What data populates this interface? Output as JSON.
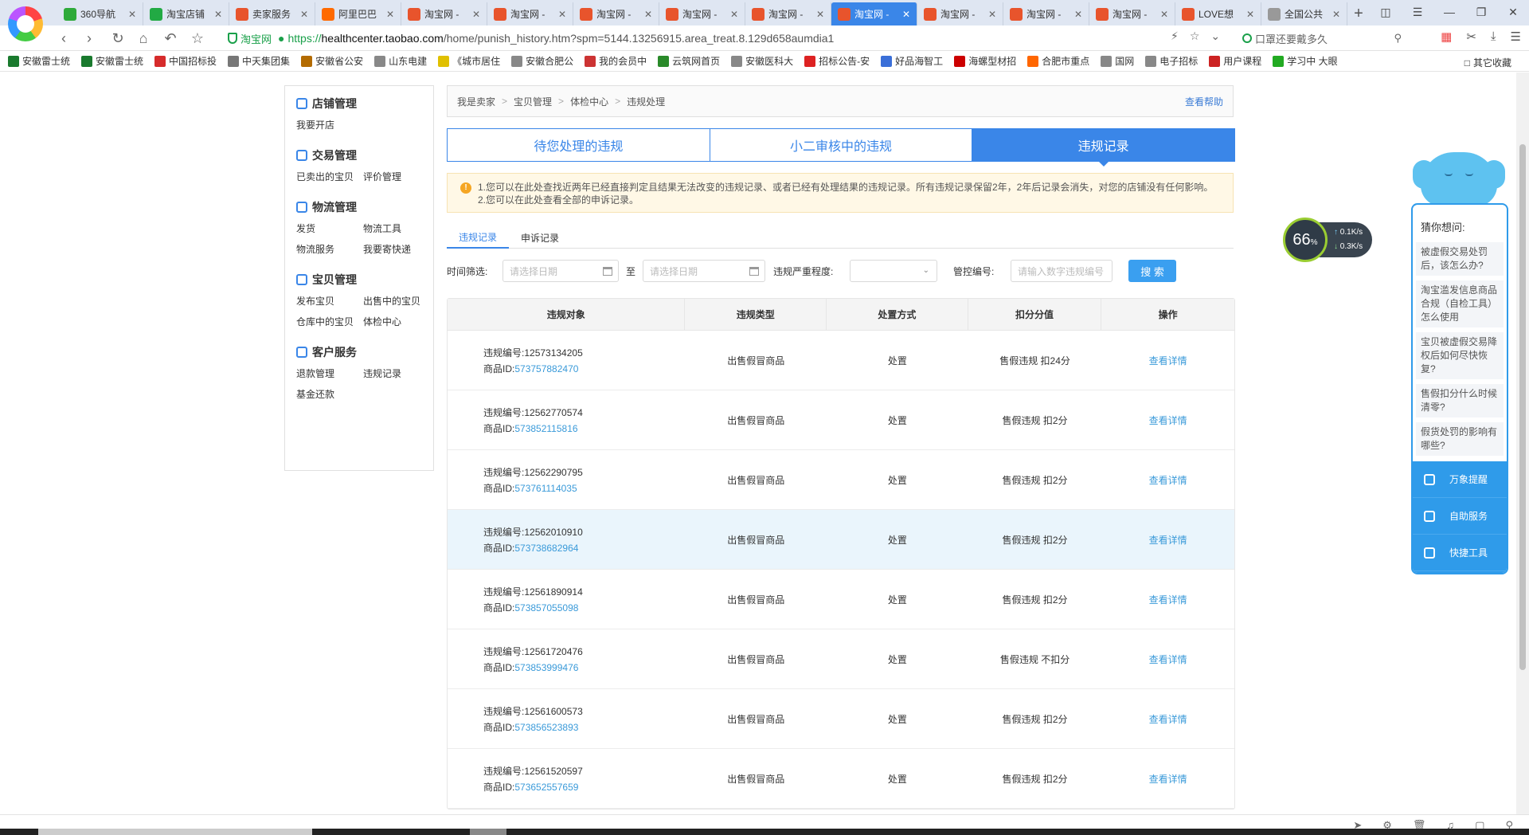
{
  "browser": {
    "tabs": [
      {
        "label": "360导航",
        "fav": "#2eaa3a"
      },
      {
        "label": "淘宝店铺",
        "fav": "#22aa44"
      },
      {
        "label": "卖家服务",
        "fav": "#e8542c"
      },
      {
        "label": "阿里巴巴",
        "fav": "#ff6a00"
      },
      {
        "label": "淘宝网 -",
        "fav": "#e8542c"
      },
      {
        "label": "淘宝网 -",
        "fav": "#e8542c"
      },
      {
        "label": "淘宝网 -",
        "fav": "#e8542c"
      },
      {
        "label": "淘宝网 -",
        "fav": "#e8542c"
      },
      {
        "label": "淘宝网 -",
        "fav": "#e8542c"
      },
      {
        "label": "淘宝网 -",
        "fav": "#e8542c",
        "active": true
      },
      {
        "label": "淘宝网 -",
        "fav": "#e8542c"
      },
      {
        "label": "淘宝网 -",
        "fav": "#e8542c"
      },
      {
        "label": "淘宝网 -",
        "fav": "#e8542c"
      },
      {
        "label": "LOVE想",
        "fav": "#e8542c"
      },
      {
        "label": "全国公共",
        "fav": "#999999"
      }
    ],
    "address": {
      "secure_label": "淘宝网",
      "scheme": "https://",
      "host": "healthcenter.taobao.com",
      "path": "/home/punish_history.htm?spm=5144.13256915.area_treat.8.129d658aumdia1"
    },
    "search_placeholder": "口罩还要戴多久",
    "bookmarks": [
      "安徽雷士统",
      "安徽雷士统",
      "中国招标投",
      "中天集团集",
      "安徽省公安",
      "山东电建",
      "《城市居住",
      "安徽合肥公",
      "我的会员中",
      "云筑网首页",
      "安徽医科大",
      "招标公告-安",
      "好品海智工",
      "海螺型材招",
      "合肥市重点",
      "国网",
      "电子招标",
      "用户课程",
      "学习中 大眼"
    ],
    "other_bookmarks": "其它收藏"
  },
  "sidebar": {
    "sections": [
      {
        "title": "店铺管理",
        "icon": "shop-icon",
        "items": [
          "我要开店"
        ]
      },
      {
        "title": "交易管理",
        "icon": "trade-icon",
        "items": [
          "已卖出的宝贝",
          "评价管理"
        ]
      },
      {
        "title": "物流管理",
        "icon": "truck-icon",
        "items": [
          "发货",
          "物流工具",
          "物流服务",
          "我要寄快递"
        ]
      },
      {
        "title": "宝贝管理",
        "icon": "bag-icon",
        "items": [
          "发布宝贝",
          "出售中的宝贝",
          "仓库中的宝贝",
          "体检中心"
        ]
      },
      {
        "title": "客户服务",
        "icon": "headset-icon",
        "items": [
          "退款管理",
          "违规记录",
          "基金还款"
        ]
      }
    ]
  },
  "breadcrumb": {
    "items": [
      "我是卖家",
      "宝贝管理",
      "体检中心",
      "违规处理"
    ],
    "help": "查看帮助"
  },
  "main_tabs": [
    {
      "label": "待您处理的违规"
    },
    {
      "label": "小二审核中的违规"
    },
    {
      "label": "违规记录",
      "active": true
    }
  ],
  "notice": {
    "line1": "1.您可以在此处查找近两年已经直接判定且结果无法改变的违规记录、或者已经有处理结果的违规记录。所有违规记录保留2年，2年后记录会消失，对您的店铺没有任何影响。",
    "line2": "2.您可以在此处查看全部的申诉记录。"
  },
  "sub_tabs": [
    {
      "label": "违规记录",
      "active": true
    },
    {
      "label": "申诉记录"
    }
  ],
  "filters": {
    "time_label": "时间筛选:",
    "date_placeholder": "请选择日期",
    "to": "至",
    "severity_label": "违规严重程度:",
    "control_label": "管控编号:",
    "control_placeholder": "请输入数字违规编号",
    "search_button": "搜 索"
  },
  "table": {
    "headers": [
      "违规对象",
      "违规类型",
      "处置方式",
      "扣分分值",
      "操作"
    ],
    "id_prefix": "违规编号:",
    "item_prefix": "商品ID:",
    "rows": [
      {
        "violation_id": "12573134205",
        "item_id": "573757882470",
        "type": "出售假冒商品",
        "method": "处置",
        "score": "售假违规 扣24分",
        "action": "查看详情"
      },
      {
        "violation_id": "12562770574",
        "item_id": "573852115816",
        "type": "出售假冒商品",
        "method": "处置",
        "score": "售假违规 扣2分",
        "action": "查看详情"
      },
      {
        "violation_id": "12562290795",
        "item_id": "573761114035",
        "type": "出售假冒商品",
        "method": "处置",
        "score": "售假违规 扣2分",
        "action": "查看详情"
      },
      {
        "violation_id": "12562010910",
        "item_id": "573738682964",
        "type": "出售假冒商品",
        "method": "处置",
        "score": "售假违规 扣2分",
        "action": "查看详情",
        "highlight": true
      },
      {
        "violation_id": "12561890914",
        "item_id": "573857055098",
        "type": "出售假冒商品",
        "method": "处置",
        "score": "售假违规 扣2分",
        "action": "查看详情"
      },
      {
        "violation_id": "12561720476",
        "item_id": "573853999476",
        "type": "出售假冒商品",
        "method": "处置",
        "score": "售假违规 不扣分",
        "action": "查看详情"
      },
      {
        "violation_id": "12561600573",
        "item_id": "573856523893",
        "type": "出售假冒商品",
        "method": "处置",
        "score": "售假违规 扣2分",
        "action": "查看详情"
      },
      {
        "violation_id": "12561520597",
        "item_id": "573652557659",
        "type": "出售假冒商品",
        "method": "处置",
        "score": "售假违规 扣2分",
        "action": "查看详情"
      }
    ]
  },
  "speed_widget": {
    "percent": "66",
    "unit": "%",
    "up": "0.1",
    "down": "0.3",
    "rate_unit": "K/s"
  },
  "helper": {
    "title": "猜你想问:",
    "questions": [
      "被虚假交易处罚后，该怎么办?",
      "淘宝滥发信息商品合规（自检工具）怎么使用",
      "宝贝被虚假交易降权后如何尽快恢复?",
      "售假扣分什么时候清零?",
      "假货处罚的影响有哪些?"
    ],
    "buttons": [
      {
        "label": "万象提醒",
        "icon": "bell-icon"
      },
      {
        "label": "自助服务",
        "icon": "chat-icon"
      },
      {
        "label": "快捷工具",
        "icon": "wrench-icon"
      }
    ]
  }
}
